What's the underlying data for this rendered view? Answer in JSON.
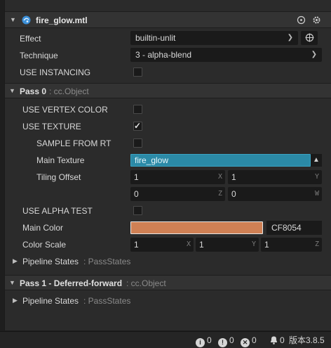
{
  "header": {
    "title": "fire_glow.mtl",
    "file_icon": "material-sphere-icon",
    "actions": [
      "target-icon",
      "settings-gear-icon"
    ]
  },
  "effect": {
    "label": "Effect",
    "value": "builtin-unlit",
    "locate_icon": "target-icon"
  },
  "technique": {
    "label": "Technique",
    "value": "3 - alpha-blend"
  },
  "instancing": {
    "label": "USE INSTANCING",
    "checked": false
  },
  "pass0": {
    "title": "Pass 0",
    "subtitle": ": cc.Object",
    "use_vertex_color": {
      "label": "USE VERTEX COLOR",
      "checked": false
    },
    "use_texture": {
      "label": "USE TEXTURE",
      "checked": true
    },
    "sample_from_rt": {
      "label": "SAMPLE FROM RT",
      "checked": false
    },
    "main_texture": {
      "label": "Main Texture",
      "value": "fire_glow"
    },
    "tiling_offset": {
      "label": "Tiling Offset",
      "x": "1",
      "y": "1",
      "z": "0",
      "w": "0",
      "axis_x": "X",
      "axis_y": "Y",
      "axis_z": "Z",
      "axis_w": "W"
    },
    "use_alpha_test": {
      "label": "USE ALPHA TEST",
      "checked": false
    },
    "main_color": {
      "label": "Main Color",
      "hex": "CF8054",
      "swatch": "#cf8054"
    },
    "color_scale": {
      "label": "Color Scale",
      "x": "1",
      "y": "1",
      "z": "1",
      "axis_x": "X",
      "axis_y": "Y",
      "axis_z": "Z"
    },
    "pipeline_states": {
      "label": "Pipeline States",
      "subtitle": ": PassStates"
    }
  },
  "pass1": {
    "title": "Pass 1 - Deferred-forward",
    "subtitle": ": cc.Object",
    "pipeline_states": {
      "label": "Pipeline States",
      "subtitle": ": PassStates"
    }
  },
  "statusbar": {
    "info_count": "0",
    "warn_count": "0",
    "error_count": "0",
    "notify_count": "0",
    "version": "版本3.8.5"
  },
  "colors": {
    "accent_field": "#2b8aa7",
    "panel_bg": "#2b2b2b",
    "header_bg": "#333333"
  }
}
